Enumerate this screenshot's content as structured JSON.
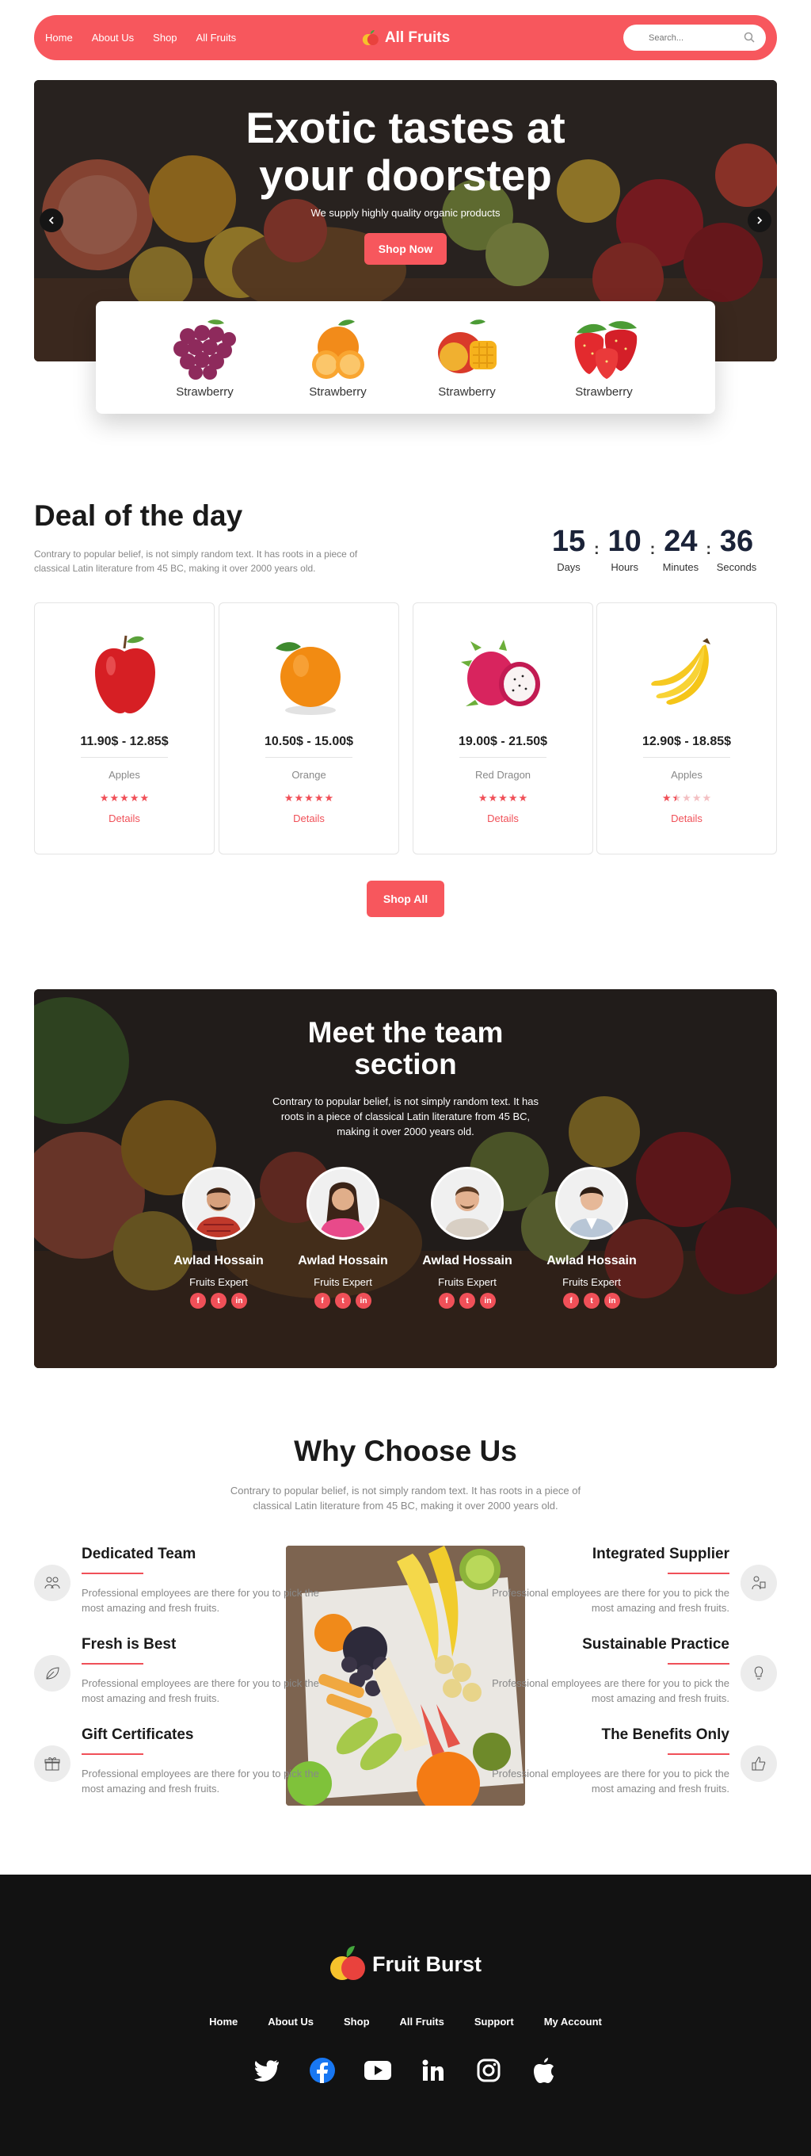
{
  "nav": {
    "links": [
      "Home",
      "About Us",
      "Shop",
      "All Fruits"
    ],
    "brand": "All Fruits",
    "search_placeholder": "Search..."
  },
  "hero": {
    "title_line1": "Exotic tastes at",
    "title_line2": "your doorstep",
    "subtitle": "We supply highly quality organic products",
    "button": "Shop Now"
  },
  "fruit_strip": [
    {
      "label": "Strawberry",
      "icon": "grapes-icon"
    },
    {
      "label": "Strawberry",
      "icon": "orange-icon"
    },
    {
      "label": "Strawberry",
      "icon": "mango-icon"
    },
    {
      "label": "Strawberry",
      "icon": "strawberry-icon"
    }
  ],
  "deal": {
    "title": "Deal of the day",
    "description": "Contrary to popular belief, is not simply random text. It has roots in a piece of classical Latin literature from 45 BC, making it over 2000 years old.",
    "countdown": [
      {
        "value": "15",
        "label": "Days"
      },
      {
        "value": "10",
        "label": "Hours"
      },
      {
        "value": "24",
        "label": "Minutes"
      },
      {
        "value": "36",
        "label": "Seconds"
      }
    ],
    "cards": [
      {
        "price": "11.90$ - 12.85$",
        "name": "Apples",
        "rating": 5,
        "details": "Details",
        "icon": "apple-icon"
      },
      {
        "price": "10.50$ - 15.00$",
        "name": "Orange",
        "rating": 5,
        "details": "Details",
        "icon": "orange-icon"
      },
      {
        "price": "19.00$ - 21.50$",
        "name": "Red Dragon",
        "rating": 5,
        "details": "Details",
        "icon": "dragonfruit-icon"
      },
      {
        "price": "12.90$ - 18.85$",
        "name": "Apples",
        "rating": 1.5,
        "details": "Details",
        "icon": "banana-icon"
      }
    ],
    "shop_all": "Shop All"
  },
  "team": {
    "title_line1": "Meet the team",
    "title_line2": "section",
    "description": "Contrary to popular belief, is not simply random text. It has roots in a piece of classical Latin literature from 45 BC, making it over 2000 years old.",
    "members": [
      {
        "name": "Awlad Hossain",
        "role": "Fruits Expert"
      },
      {
        "name": "Awlad Hossain",
        "role": "Fruits Expert"
      },
      {
        "name": "Awlad Hossain",
        "role": "Fruits Expert"
      },
      {
        "name": "Awlad Hossain",
        "role": "Fruits Expert"
      }
    ]
  },
  "why": {
    "title": "Why Choose Us",
    "description": "Contrary to popular belief, is not simply random text. It has roots in a piece of classical Latin literature from 45 BC, making it over 2000 years old.",
    "left": [
      {
        "title": "Dedicated Team",
        "text": "Professional employees are there for you to pick the most amazing and fresh fruits.",
        "icon": "team-icon"
      },
      {
        "title": "Fresh is Best",
        "text": "Professional employees are there for you to pick the most amazing and fresh fruits.",
        "icon": "leaf-icon"
      },
      {
        "title": "Gift Certificates",
        "text": "Professional employees are there for you to pick the most amazing and fresh fruits.",
        "icon": "gift-icon"
      }
    ],
    "right": [
      {
        "title": "Integrated Supplier",
        "text": "Professional employees are there for you to pick the most amazing and fresh fruits.",
        "icon": "supplier-icon"
      },
      {
        "title": "Sustainable Practice",
        "text": "Professional employees are there for you to pick the most amazing and fresh fruits.",
        "icon": "bulb-icon"
      },
      {
        "title": "The Benefits Only",
        "text": "Professional employees are there for you to pick the most amazing and fresh fruits.",
        "icon": "thumbs-up-icon"
      }
    ]
  },
  "footer": {
    "brand": "Fruit Burst",
    "links": [
      "Home",
      "About Us",
      "Shop",
      "All Fruits",
      "Support",
      "My Account"
    ],
    "social": [
      "twitter-icon",
      "facebook-icon",
      "youtube-icon",
      "linkedin-icon",
      "instagram-icon",
      "apple-icon"
    ]
  },
  "colors": {
    "accent": "#f7575d",
    "dark": "#121212",
    "countdown": "#1a2238"
  }
}
